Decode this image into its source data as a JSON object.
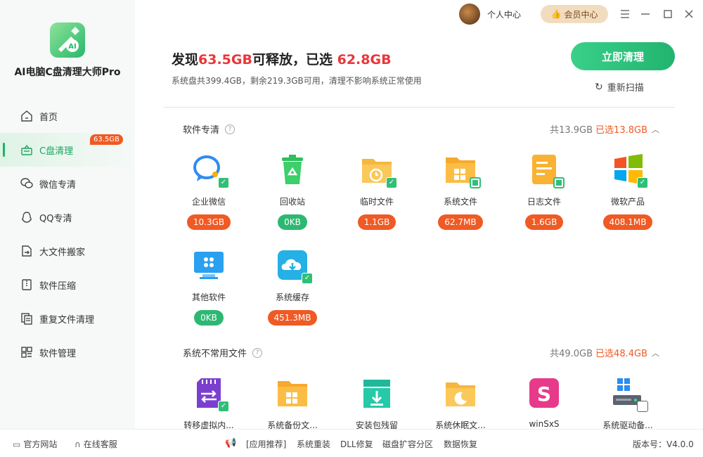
{
  "app": {
    "name": "AI电脑C盘清理大师Pro"
  },
  "sidebar": {
    "items": [
      {
        "label": "首页",
        "icon": "home-icon"
      },
      {
        "label": "C盘清理",
        "icon": "drive-clean-icon",
        "badge": "63.5GB",
        "active": true
      },
      {
        "label": "微信专清",
        "icon": "wechat-icon"
      },
      {
        "label": "QQ专清",
        "icon": "qq-icon"
      },
      {
        "label": "大文件搬家",
        "icon": "file-move-icon"
      },
      {
        "label": "软件压缩",
        "icon": "compress-icon"
      },
      {
        "label": "重复文件清理",
        "icon": "duplicate-file-icon"
      },
      {
        "label": "软件管理",
        "icon": "app-grid-icon"
      }
    ]
  },
  "topbar": {
    "personal": "个人中心",
    "vip": "会员中心"
  },
  "header": {
    "found_prefix": "发现",
    "found_value": "63.5GB",
    "found_suffix": "可释放，已选 ",
    "selected_value": "62.8GB",
    "subline": "系统盘共399.4GB，剩余219.3GB可用，清理不影响系统正常使用",
    "clean_button": "立即清理",
    "rescan": "重新扫描"
  },
  "sections": [
    {
      "title": "软件专清",
      "total": "共13.9GB",
      "selected": "已选13.8GB",
      "tiles": [
        {
          "name": "企业微信",
          "size": "10.3GB",
          "tone": "orange",
          "icon": "wecom-icon",
          "check": "checked"
        },
        {
          "name": "回收站",
          "size": "0KB",
          "tone": "green",
          "icon": "recycle-bin-icon",
          "check": "none"
        },
        {
          "name": "临时文件",
          "size": "1.1GB",
          "tone": "orange",
          "icon": "temp-folder-icon",
          "check": "checked"
        },
        {
          "name": "系统文件",
          "size": "62.7MB",
          "tone": "orange",
          "icon": "system-folder-icon",
          "check": "partial"
        },
        {
          "name": "日志文件",
          "size": "1.6GB",
          "tone": "orange",
          "icon": "log-file-icon",
          "check": "partial"
        },
        {
          "name": "微软产品",
          "size": "408.1MB",
          "tone": "orange",
          "icon": "windows-logo-icon",
          "check": "checked"
        },
        {
          "name": "其他软件",
          "size": "0KB",
          "tone": "green",
          "icon": "monitor-icon",
          "check": "none"
        },
        {
          "name": "系统缓存",
          "size": "451.3MB",
          "tone": "orange",
          "icon": "cloud-download-icon",
          "check": "checked"
        }
      ]
    },
    {
      "title": "系统不常用文件",
      "total": "共49.0GB",
      "selected": "已选48.4GB",
      "tiles": [
        {
          "name": "转移虚拟内...",
          "icon": "memory-transfer-icon",
          "check": "checked"
        },
        {
          "name": "系统备份文...",
          "icon": "backup-folder-icon",
          "check": "none"
        },
        {
          "name": "安装包残留",
          "icon": "install-package-icon",
          "check": "none"
        },
        {
          "name": "系统休眠文...",
          "icon": "hibernate-folder-icon",
          "check": "none"
        },
        {
          "name": "winSxS",
          "icon": "winsxs-icon",
          "check": "none"
        },
        {
          "name": "系统驱动备...",
          "icon": "driver-backup-icon",
          "check": "empty"
        }
      ]
    }
  ],
  "footer": {
    "website": "官方网站",
    "support": "在线客服",
    "links": [
      "[应用推荐]",
      "系统重装",
      "DLL修复",
      "磁盘扩容分区",
      "数据恢复"
    ],
    "version": "版本号：V4.0.0"
  },
  "colors": {
    "accent": "#21b46e",
    "highlight": "#e8373a",
    "badge": "#f05a24"
  }
}
